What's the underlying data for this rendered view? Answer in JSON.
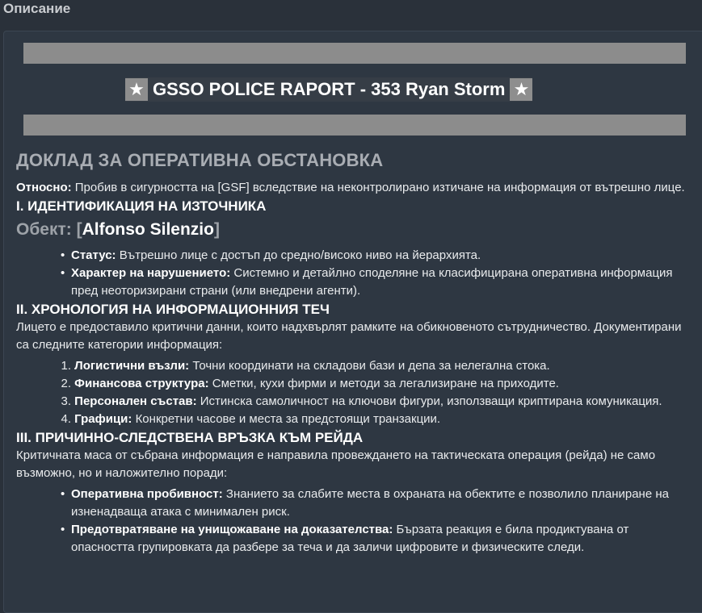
{
  "section_title": "Описание",
  "banner": {
    "star_left": "★",
    "title": "GSSO POLICE RAPORT - 353 Ryan Storm",
    "star_right": "★"
  },
  "report_title": "ДОКЛАД ЗА ОПЕРАТИВНА ОБСТАНОВКА",
  "regarding": {
    "label": "Относно:",
    "text": " Пробив в сигурността на [GSF] вследствие на неконтролирано изтичане на информация от вътрешно лице."
  },
  "section1": {
    "heading": "I. ИДЕНТИФИКАЦИЯ НА ИЗТОЧНИКА",
    "subject_label": "Обект: [",
    "subject_name": "Alfonso Silenzio",
    "subject_close": "]",
    "bullets": [
      {
        "label": "Статус:",
        "text": " Вътрешно лице с достъп до средно/високо ниво на йерархията."
      },
      {
        "label": "Характер на нарушението:",
        "text": " Системно и детайлно споделяне на класифицирана оперативна информация пред неоторизирани страни (или внедрени агенти)."
      }
    ]
  },
  "section2": {
    "heading": "II. ХРОНОЛОГИЯ НА ИНФОРМАЦИОННИЯ ТЕЧ",
    "intro": "Лицето е предоставило критични данни, които надхвърлят рамките на обикновеното сътрудничество. Документирани са следните категории информация:",
    "items": [
      {
        "num": "1.",
        "label": "Логистични възли:",
        "text": " Точни координати на складови бази и депа за нелегална стока."
      },
      {
        "num": "2.",
        "label": "Финансова структура:",
        "text": " Сметки, кухи фирми и методи за легализиране на приходите."
      },
      {
        "num": "3.",
        "label": "Персонален състав:",
        "text": " Истинска самоличност на ключови фигури, използващи криптирана комуникация."
      },
      {
        "num": "4.",
        "label": "Графици:",
        "text": " Конкретни часове и места за предстоящи транзакции."
      }
    ]
  },
  "section3": {
    "heading": "III. ПРИЧИННО-СЛЕДСТВЕНА ВРЪЗКА КЪМ РЕЙДА",
    "intro": "Критичната маса от събрана информация е направила провеждането на тактическата операция (рейда) не само възможно, но и наложително поради:",
    "bullets": [
      {
        "label": "Оперативна пробивност:",
        "text": " Знанието за слабите места в охраната на обектите е позволило планиране на изненадваща атака с минимален риск."
      },
      {
        "label": "Предотвратяване на унищожаване на доказателства:",
        "text": " Бързата реакция е била продиктувана от опасността групировката да разбере за теча и да заличи цифровите и физическите следи."
      }
    ]
  }
}
